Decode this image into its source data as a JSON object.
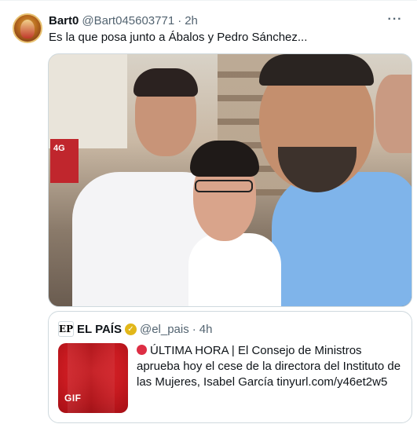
{
  "tweet": {
    "display_name": "Bart0",
    "handle": "@Bart045603771",
    "separator": "·",
    "time": "2h",
    "more_label": "···",
    "text": "Es la que posa junto a Ábalos y Pedro Sánchez..."
  },
  "quote": {
    "logo_letters": "EP",
    "display_name": "EL PAÍS",
    "verified": "✓",
    "handle": "@el_pais",
    "separator": "·",
    "time": "4h",
    "text": "ÚLTIMA HORA | El Consejo de Ministros aprueba hoy el cese de la directora del Instituto de las Mujeres, Isabel García tinyurl.com/y46et2w5",
    "media_badge": "GIF"
  },
  "photo": {
    "sign_text": "4G"
  },
  "colors": {
    "text": "#0f1419",
    "muted": "#536471",
    "border": "#cfd9de",
    "verified_gold": "#e2b719",
    "gif_red": "#c81a20"
  },
  "icons": [
    "avatar",
    "more-icon",
    "verified-icon",
    "red-circle-icon"
  ]
}
